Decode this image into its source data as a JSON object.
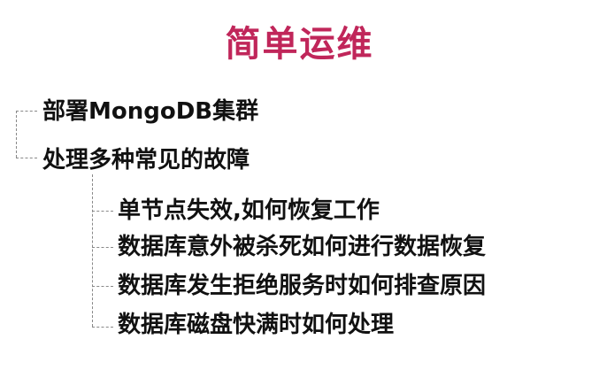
{
  "title": "简单运维",
  "colors": {
    "title": "#c0265a",
    "text": "#111111",
    "connector": "#888888"
  },
  "items": [
    {
      "label": "部署MongoDB集群",
      "level": 1
    },
    {
      "label": "处理多种常见的故障",
      "level": 1,
      "children": [
        {
          "label": "单节点失效,如何恢复工作",
          "level": 2
        },
        {
          "label": "数据库意外被杀死如何进行数据恢复",
          "level": 2
        },
        {
          "label": "数据库发生拒绝服务时如何排查原因",
          "level": 2
        },
        {
          "label": "数据库磁盘快满时如何处理",
          "level": 2
        }
      ]
    }
  ]
}
